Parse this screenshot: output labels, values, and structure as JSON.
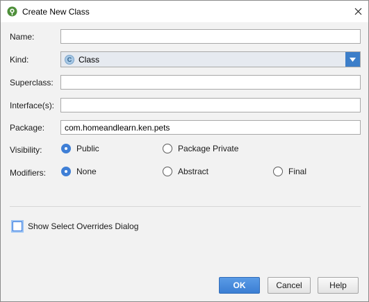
{
  "window": {
    "title": "Create New Class",
    "title_icon": "android-studio-icon",
    "close_icon": "close-icon"
  },
  "form": {
    "name_label": "Name:",
    "name_value": "",
    "kind_label": "Kind:",
    "kind_value": "Class",
    "kind_badge": "C",
    "superclass_label": "Superclass:",
    "superclass_value": "",
    "interfaces_label": "Interface(s):",
    "interfaces_value": "",
    "package_label": "Package:",
    "package_value": "com.homeandlearn.ken.pets"
  },
  "visibility": {
    "label": "Visibility:",
    "options": [
      "Public",
      "Package Private"
    ],
    "selected": "Public"
  },
  "modifiers": {
    "label": "Modifiers:",
    "options": [
      "None",
      "Abstract",
      "Final"
    ],
    "selected": "None"
  },
  "overrides_checkbox": {
    "label": "Show Select Overrides Dialog",
    "checked": false
  },
  "buttons": {
    "ok": "OK",
    "cancel": "Cancel",
    "help": "Help"
  },
  "colors": {
    "accent": "#3f7fd6",
    "dropdown_arrow_bg": "#3c7ec9"
  }
}
